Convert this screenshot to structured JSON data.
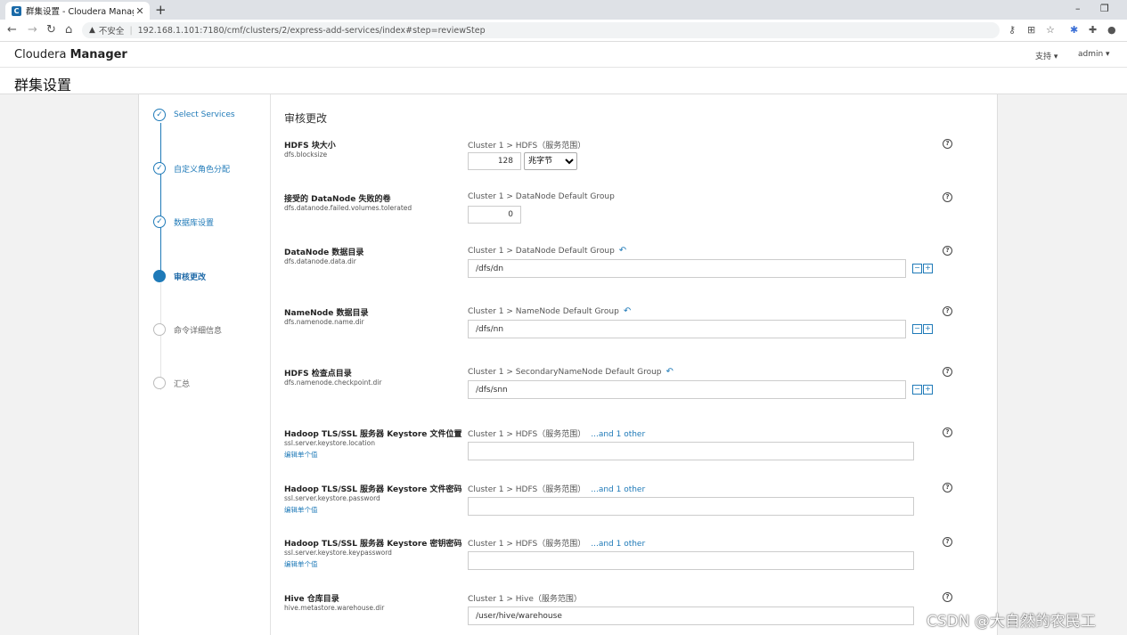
{
  "browser": {
    "tab_title": "群集设置 - Cloudera Manager",
    "tab_close": "✕",
    "newtab": "+",
    "minimize": "–",
    "restore": "❐",
    "security_label": "不安全",
    "url": "192.168.1.101:7180/cmf/clusters/2/express-add-services/index#step=reviewStep"
  },
  "header": {
    "brand_light": "Cloudera ",
    "brand_bold": "Manager",
    "support": "支持 ▾",
    "user": "admin ▾",
    "page_title": "群集设置"
  },
  "steps": [
    {
      "label": "Select Services",
      "state": "done"
    },
    {
      "label": "自定义角色分配",
      "state": "done"
    },
    {
      "label": "数据库设置",
      "state": "done"
    },
    {
      "label": "审核更改",
      "state": "current"
    },
    {
      "label": "命令详细信息",
      "state": "todo"
    },
    {
      "label": "汇总",
      "state": "todo"
    }
  ],
  "review": {
    "title": "审核更改",
    "help": "?",
    "other_label": "...and 1 other",
    "edit_label": "编辑单个值",
    "undo": "↶",
    "params": [
      {
        "name": "HDFS 块大小",
        "key": "dfs.blocksize",
        "scope": "Cluster 1 > HDFS（服务范围）",
        "value": "128",
        "unit": "兆字节"
      },
      {
        "name": "接受的 DataNode 失败的卷",
        "key": "dfs.datanode.failed.volumes.tolerated",
        "scope": "Cluster 1 > DataNode Default Group",
        "value": "0"
      },
      {
        "name": "DataNode 数据目录",
        "key": "dfs.datanode.data.dir",
        "scope": "Cluster 1 > DataNode Default Group",
        "value": "/dfs/dn"
      },
      {
        "name": "NameNode 数据目录",
        "key": "dfs.namenode.name.dir",
        "scope": "Cluster 1 > NameNode Default Group",
        "value": "/dfs/nn"
      },
      {
        "name": "HDFS 检查点目录",
        "key": "dfs.namenode.checkpoint.dir",
        "scope": "Cluster 1 > SecondaryNameNode Default Group",
        "value": "/dfs/snn"
      },
      {
        "name": "Hadoop TLS/SSL 服务器 Keystore 文件位置",
        "key": "ssl.server.keystore.location",
        "scope": "Cluster 1 > HDFS（服务范围）",
        "value": ""
      },
      {
        "name": "Hadoop TLS/SSL 服务器 Keystore 文件密码",
        "key": "ssl.server.keystore.password",
        "scope": "Cluster 1 > HDFS（服务范围）",
        "value": ""
      },
      {
        "name": "Hadoop TLS/SSL 服务器 Keystore 密钥密码",
        "key": "ssl.server.keystore.keypassword",
        "scope": "Cluster 1 > HDFS（服务范围）",
        "value": ""
      },
      {
        "name": "Hive 仓库目录",
        "key": "hive.metastore.warehouse.dir",
        "scope": "Cluster 1 > Hive（服务范围）",
        "value": "/user/hive/warehouse"
      }
    ]
  },
  "watermark": "CSDN @大自然的农民工",
  "colors": {
    "accent": "#1f7ab8"
  }
}
